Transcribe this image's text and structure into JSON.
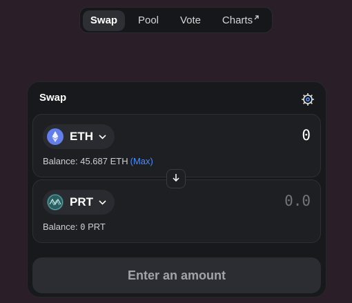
{
  "nav": {
    "items": [
      {
        "label": "Swap",
        "active": true
      },
      {
        "label": "Pool",
        "active": false
      },
      {
        "label": "Vote",
        "active": false
      },
      {
        "label": "Charts",
        "active": false,
        "icon": "external-arrow-icon"
      }
    ]
  },
  "card": {
    "title": "Swap",
    "settings_icon": "gear-icon"
  },
  "input_panel": {
    "token_symbol": "ETH",
    "token_icon": "ethereum-logo-icon",
    "amount": "0",
    "balance_label": "Balance:",
    "balance_value": "45.687",
    "balance_symbol": "ETH",
    "max_label": "(Max)"
  },
  "output_panel": {
    "token_symbol": "PRT",
    "token_icon": "prt-logo-icon",
    "amount_placeholder": "0.0",
    "balance_label": "Balance:",
    "balance_value": "0",
    "balance_symbol": "PRT"
  },
  "switch_icon": "arrow-down-icon",
  "submit_label": "Enter an amount",
  "colors": {
    "background": "#2a1f29",
    "card": "#18191c",
    "panel": "#1e1f23",
    "accent_link": "#4a8dff",
    "eth_logo": "#627eea",
    "prt_logo": "#2a5d60"
  }
}
